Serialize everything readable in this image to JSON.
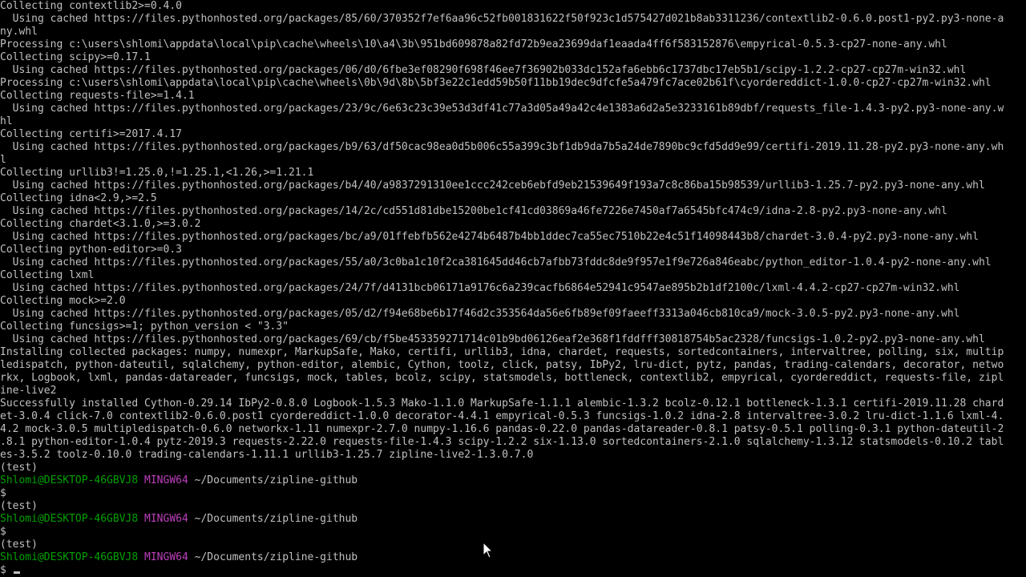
{
  "terminal": {
    "lines": [
      "Collecting contextlib2>=0.4.0",
      "  Using cached https://files.pythonhosted.org/packages/85/60/370352f7ef6aa96c52fb001831622f50f923c1d575427d021b8ab3311236/contextlib2-0.6.0.post1-py2.py3-none-a",
      "ny.whl",
      "Processing c:\\users\\shlomi\\appdata\\local\\pip\\cache\\wheels\\10\\a4\\3b\\951bd609878a82fd72b9ea23699daf1eaada4ff6f583152876\\empyrical-0.5.3-cp27-none-any.whl",
      "Collecting scipy>=0.17.1",
      "  Using cached https://files.pythonhosted.org/packages/06/d0/6fbe3ef08290f698f46ee7f36902b033dc152afa6ebb6c1737dbc17eb5b1/scipy-1.2.2-cp27-cp27m-win32.whl",
      "Processing c:\\users\\shlomi\\appdata\\local\\pip\\cache\\wheels\\0b\\9d\\8b\\5bf3e22c1edd59b50f11bb19dec9dfcfe5a479fc7ace02b61f\\cyordereddict-1.0.0-cp27-cp27m-win32.whl",
      "Collecting requests-file>=1.4.1",
      "  Using cached https://files.pythonhosted.org/packages/23/9c/6e63c23c39e53d3df41c77a3d05a49a42c4e1383a6d2a5e3233161b89dbf/requests_file-1.4.3-py2.py3-none-any.w",
      "hl",
      "Collecting certifi>=2017.4.17",
      "  Using cached https://files.pythonhosted.org/packages/b9/63/df50cac98ea0d5b006c55a399c3bf1db9da7b5a24de7890bc9cfd5dd9e99/certifi-2019.11.28-py2.py3-none-any.wh",
      "l",
      "Collecting urllib3!=1.25.0,!=1.25.1,<1.26,>=1.21.1",
      "  Using cached https://files.pythonhosted.org/packages/b4/40/a9837291310ee1ccc242ceb6ebfd9eb21539649f193a7c8c86ba15b98539/urllib3-1.25.7-py2.py3-none-any.whl",
      "Collecting idna<2.9,>=2.5",
      "  Using cached https://files.pythonhosted.org/packages/14/2c/cd551d81dbe15200be1cf41cd03869a46fe7226e7450af7a6545bfc474c9/idna-2.8-py2.py3-none-any.whl",
      "Collecting chardet<3.1.0,>=3.0.2",
      "  Using cached https://files.pythonhosted.org/packages/bc/a9/01ffebfb562e4274b6487b4bb1ddec7ca55ec7510b22e4c51f14098443b8/chardet-3.0.4-py2.py3-none-any.whl",
      "Collecting python-editor>=0.3",
      "  Using cached https://files.pythonhosted.org/packages/55/a0/3c0ba1c10f2ca381645dd46cb7afbb73fddc8de9f957e1f9e726a846eabc/python_editor-1.0.4-py2-none-any.whl",
      "Collecting lxml",
      "  Using cached https://files.pythonhosted.org/packages/24/7f/d4131bcb06171a9176c6a239cacfb6864e52941c9547ae895b2b1df2100c/lxml-4.4.2-cp27-cp27m-win32.whl",
      "Collecting mock>=2.0",
      "  Using cached https://files.pythonhosted.org/packages/05/d2/f94e68be6b17f46d2c353564da56e6fb89ef09faeeff3313a046cb810ca9/mock-3.0.5-py2.py3-none-any.whl",
      "Collecting funcsigs>=1; python_version < \"3.3\"",
      "  Using cached https://files.pythonhosted.org/packages/69/cb/f5be453359271714c01b9bd06126eaf2e368f1fddfff30818754b5ac2328/funcsigs-1.0.2-py2.py3-none-any.whl",
      "Installing collected packages: numpy, numexpr, MarkupSafe, Mako, certifi, urllib3, idna, chardet, requests, sortedcontainers, intervaltree, polling, six, multip",
      "ledispatch, python-dateutil, sqlalchemy, python-editor, alembic, Cython, toolz, click, patsy, IbPy2, lru-dict, pytz, pandas, trading-calendars, decorator, netwo",
      "rkx, Logbook, lxml, pandas-datareader, funcsigs, mock, tables, bcolz, scipy, statsmodels, bottleneck, contextlib2, empyrical, cyordereddict, requests-file, zipl",
      "ine-live2",
      "Successfully installed Cython-0.29.14 IbPy2-0.8.0 Logbook-1.5.3 Mako-1.1.0 MarkupSafe-1.1.1 alembic-1.3.2 bcolz-0.12.1 bottleneck-1.3.1 certifi-2019.11.28 chard",
      "et-3.0.4 click-7.0 contextlib2-0.6.0.post1 cyordereddict-1.0.0 decorator-4.4.1 empyrical-0.5.3 funcsigs-1.0.2 idna-2.8 intervaltree-3.0.2 lru-dict-1.1.6 lxml-4.",
      "4.2 mock-3.0.5 multipledispatch-0.6.0 networkx-1.11 numexpr-2.7.0 numpy-1.16.6 pandas-0.22.0 pandas-datareader-0.8.1 patsy-0.5.1 polling-0.3.1 python-dateutil-2",
      ".8.1 python-editor-1.0.4 pytz-2019.3 requests-2.22.0 requests-file-1.4.3 scipy-1.2.2 six-1.13.0 sortedcontainers-2.1.0 sqlalchemy-1.3.12 statsmodels-0.10.2 tabl",
      "es-3.5.2 toolz-0.10.0 trading-calendars-1.11.1 urllib3-1.25.7 zipline-live2-1.3.0.7.0"
    ],
    "sessions": [
      {
        "env": "(test)",
        "user": "Shlomi@DESKTOP-46GBVJ8",
        "system": "MINGW64",
        "path": "~/Documents/zipline-github",
        "input": "$"
      },
      {
        "env": "(test)",
        "user": "Shlomi@DESKTOP-46GBVJ8",
        "system": "MINGW64",
        "path": "~/Documents/zipline-github",
        "input": "$"
      },
      {
        "env": "(test)",
        "user": "Shlomi@DESKTOP-46GBVJ8",
        "system": "MINGW64",
        "path": "~/Documents/zipline-github",
        "input": "$"
      }
    ]
  },
  "icons": {
    "cursor": "text-cursor-icon",
    "pointer": "mouse-pointer-icon"
  },
  "colors": {
    "background": "#000000",
    "text": "#c0c0c0",
    "prompt_user": "#00a100",
    "prompt_system": "#bc3fbc"
  }
}
